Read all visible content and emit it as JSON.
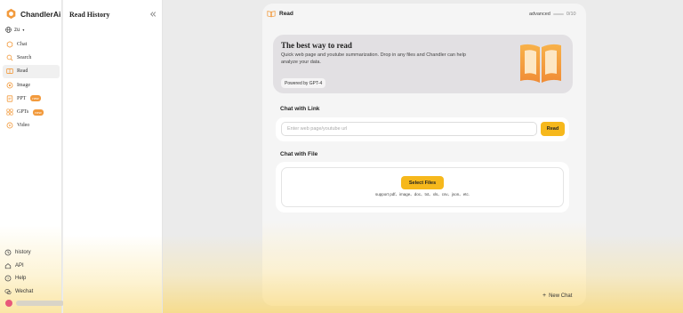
{
  "app": {
    "name": "ChandlerAi",
    "language": "zu"
  },
  "nav": {
    "items": [
      {
        "label": "Chat",
        "icon": "chat-icon",
        "active": false
      },
      {
        "label": "Search",
        "icon": "search-icon",
        "active": false
      },
      {
        "label": "Read",
        "icon": "book-icon",
        "active": true
      },
      {
        "label": "Image",
        "icon": "image-icon",
        "active": false
      },
      {
        "label": "PPT",
        "icon": "ppt-icon",
        "active": false,
        "badge": "new"
      },
      {
        "label": "GPTs",
        "icon": "gpts-icon",
        "active": false,
        "badge": "new"
      },
      {
        "label": "Video",
        "icon": "video-icon",
        "active": false
      }
    ],
    "bottom": [
      {
        "label": "history",
        "icon": "history-icon"
      },
      {
        "label": "API",
        "icon": "api-icon"
      },
      {
        "label": "Help",
        "icon": "help-icon"
      },
      {
        "label": "Wechat",
        "icon": "wechat-icon"
      }
    ]
  },
  "history": {
    "title": "Read History"
  },
  "main": {
    "title": "Read",
    "mode_label": "advanced",
    "mode_count": "0/10",
    "hero": {
      "title": "The best way to read",
      "description": "Quick web page and youtube summarization. Drop in any files and Chandler can help analyze your data.",
      "chip": "Powered by GPT-4"
    },
    "link": {
      "title": "Chat with Link",
      "placeholder": "Enter web page/youtube url",
      "button": "Read"
    },
    "file": {
      "title": "Chat with File",
      "button": "Select Files",
      "support": "support pdf、image、doc、txt、xls、csv、json、etc."
    },
    "new_chat": "New Chat"
  },
  "colors": {
    "accent": "#f6b81c",
    "badge": "#f29a3c",
    "brand": "#f29a3c"
  }
}
